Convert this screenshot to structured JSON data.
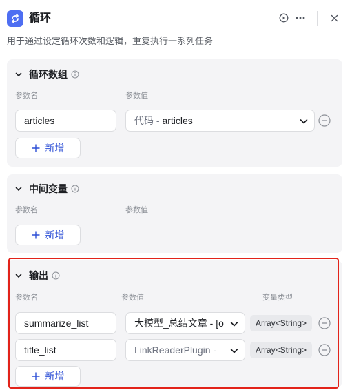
{
  "header": {
    "title": "循环",
    "description": "用于通过设定循环次数和逻辑，重复执行一系列任务",
    "icons": [
      "loop-logo-icon",
      "play-circle-icon",
      "more-icon",
      "close-icon"
    ]
  },
  "loop_array": {
    "title": "循环数组",
    "col_name": "参数名",
    "col_value": "参数值",
    "rows": [
      {
        "name": "articles",
        "value_prefix": "代码 - ",
        "value_suffix": "articles"
      }
    ],
    "add_label": "新增"
  },
  "intermediate": {
    "title": "中间变量",
    "col_name": "参数名",
    "col_value": "参数值",
    "add_label": "新增"
  },
  "output": {
    "title": "输出",
    "col_name": "参数名",
    "col_value": "参数值",
    "col_type": "变量类型",
    "rows": [
      {
        "name": "summarize_list",
        "value": "大模型_总结文章 - [o",
        "type": "Array<String>"
      },
      {
        "name": "title_list",
        "value": "LinkReaderPlugin - ",
        "type": "Array<String>"
      }
    ],
    "add_label": "新增"
  },
  "colors": {
    "accent": "#4e6ef2",
    "link": "#2d4fd6",
    "highlight": "#e2231a",
    "section_bg": "#f4f4f6"
  }
}
